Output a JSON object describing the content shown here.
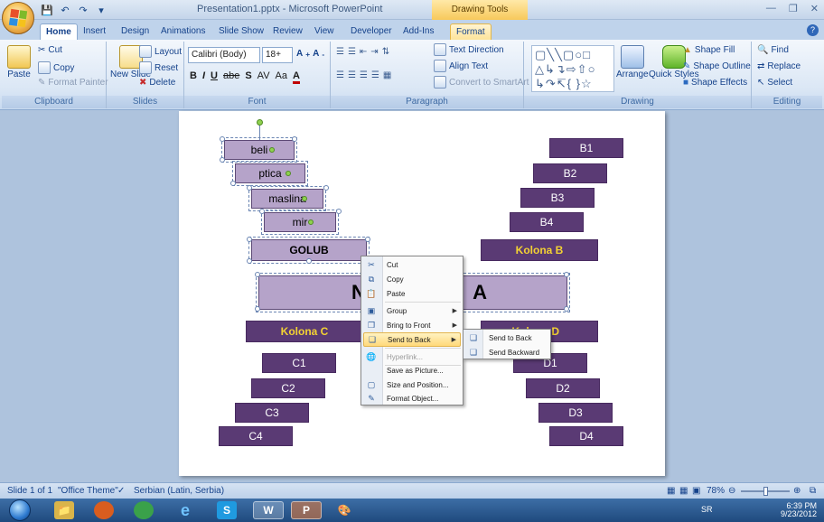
{
  "titlebar": {
    "title": "Presentation1.pptx - Microsoft PowerPoint",
    "contextual": "Drawing Tools",
    "qat": [
      "save-icon",
      "undo-icon",
      "redo-icon",
      "customize-icon"
    ]
  },
  "tabs": [
    "Home",
    "Insert",
    "Design",
    "Animations",
    "Slide Show",
    "Review",
    "View",
    "Developer",
    "Add-Ins",
    "Format"
  ],
  "ribbon": {
    "clipboard": {
      "label": "Clipboard",
      "paste": "Paste",
      "cut": "Cut",
      "copy": "Copy",
      "format_painter": "Format Painter"
    },
    "slides": {
      "label": "Slides",
      "new_slide": "New Slide",
      "layout": "Layout",
      "reset": "Reset",
      "delete": "Delete"
    },
    "font": {
      "label": "Font",
      "family": "Calibri (Body)",
      "size": "18+"
    },
    "paragraph": {
      "label": "Paragraph",
      "text_direction": "Text Direction",
      "align_text": "Align Text",
      "convert": "Convert to SmartArt"
    },
    "drawing": {
      "label": "Drawing",
      "arrange": "Arrange",
      "quick_styles": "Quick Styles",
      "shape_fill": "Shape Fill",
      "shape_outline": "Shape Outline",
      "shape_effects": "Shape Effects"
    },
    "editing": {
      "label": "Editing",
      "find": "Find",
      "replace": "Replace",
      "select": "Select"
    }
  },
  "slide": {
    "left_items": [
      "beli",
      "ptica",
      "maslina",
      "mir"
    ],
    "golub": "GOLUB",
    "center_left": "N",
    "center_right": "A",
    "kolona_b": "Kolona B",
    "kolona_c": "Kolona C",
    "kolona_d": "Kolona D",
    "b_items": [
      "B1",
      "B2",
      "B3",
      "B4"
    ],
    "c_items": [
      "C1",
      "C2",
      "C3",
      "C4"
    ],
    "d_items": [
      "D1",
      "D2",
      "D3",
      "D4"
    ]
  },
  "context_menu": {
    "cut": "Cut",
    "copy": "Copy",
    "paste": "Paste",
    "group": "Group",
    "bring_to_front": "Bring to Front",
    "send_to_back": "Send to Back",
    "hyperlink": "Hyperlink...",
    "save_as_picture": "Save as Picture...",
    "size_position": "Size and Position...",
    "format_object": "Format Object..."
  },
  "submenu": {
    "send_to_back": "Send to Back",
    "send_backward": "Send Backward"
  },
  "statusbar": {
    "slide": "Slide 1 of 1",
    "theme": "\"Office Theme\"",
    "language": "Serbian (Latin, Serbia)",
    "zoom": "78%"
  },
  "taskbar": {
    "lang": "SR",
    "time": "6:39 PM",
    "date": "9/23/2012"
  }
}
